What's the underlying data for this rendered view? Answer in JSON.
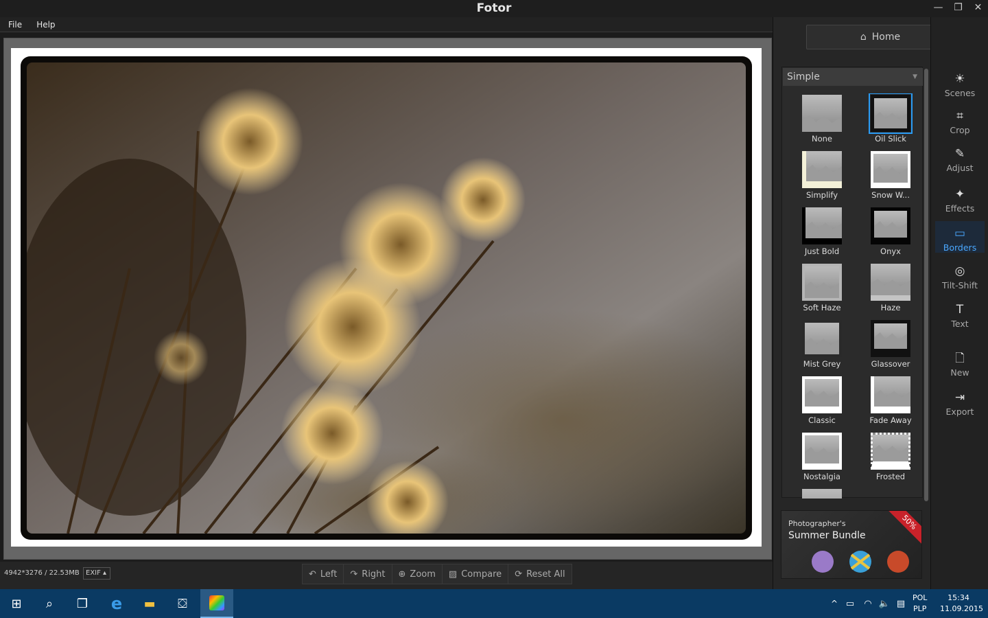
{
  "window": {
    "title": "Fotor",
    "minimize": "—",
    "restore": "❐",
    "close": "✕"
  },
  "menu": {
    "file": "File",
    "help": "Help"
  },
  "status": {
    "dimensions": "4942*3276 / 22.53MB",
    "exif": "EXIF ▴"
  },
  "toolbar": {
    "left": "Left",
    "right": "Right",
    "zoom": "Zoom",
    "compare": "Compare",
    "reset": "Reset All"
  },
  "sidebar": {
    "home_label": "Home",
    "dropdown_value": "Simple",
    "borders": [
      {
        "label": "None"
      },
      {
        "label": "Oil Slick"
      },
      {
        "label": "Simplify"
      },
      {
        "label": "Snow W..."
      },
      {
        "label": "Just Bold"
      },
      {
        "label": "Onyx"
      },
      {
        "label": "Soft Haze"
      },
      {
        "label": "Haze"
      },
      {
        "label": "Mist Grey"
      },
      {
        "label": "Glassover"
      },
      {
        "label": "Classic"
      },
      {
        "label": "Fade Away"
      },
      {
        "label": "Nostalgia"
      },
      {
        "label": "Frosted"
      }
    ],
    "ad": {
      "line1": "Photographer's",
      "line2": "Summer Bundle",
      "badge": "50%"
    }
  },
  "tools": [
    {
      "label": "Scenes",
      "icon": "☀"
    },
    {
      "label": "Crop",
      "icon": "⌗"
    },
    {
      "label": "Adjust",
      "icon": "✎"
    },
    {
      "label": "Effects",
      "icon": "✦"
    },
    {
      "label": "Borders",
      "icon": "▭"
    },
    {
      "label": "Tilt-Shift",
      "icon": "◎"
    },
    {
      "label": "Text",
      "icon": "T"
    },
    {
      "label": "New",
      "icon": "🗋"
    },
    {
      "label": "Export",
      "icon": "⇥"
    }
  ],
  "taskbar": {
    "lang1": "POL",
    "lang2": "PLP",
    "time": "15:34",
    "date": "11.09.2015"
  }
}
